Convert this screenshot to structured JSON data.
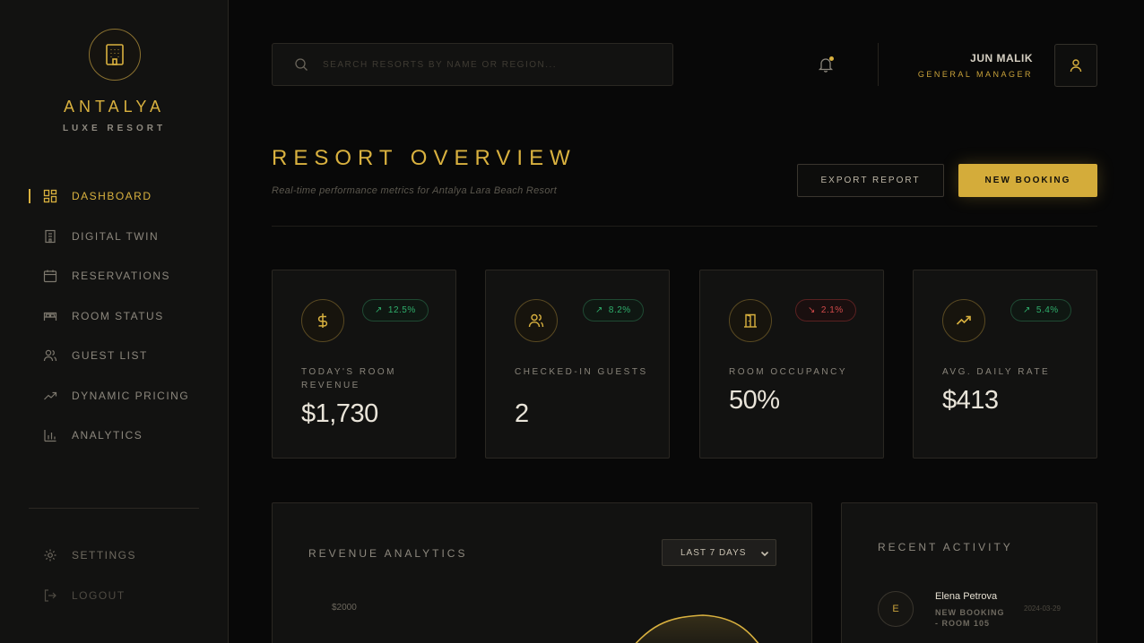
{
  "brand": {
    "name": "ANTALYA",
    "subtitle": "LUXE RESORT"
  },
  "sidebar": {
    "items": [
      {
        "label": "DASHBOARD",
        "icon": "dashboard-grid-icon",
        "active": true
      },
      {
        "label": "DIGITAL TWIN",
        "icon": "building-icon"
      },
      {
        "label": "RESERVATIONS",
        "icon": "calendar-icon"
      },
      {
        "label": "ROOM STATUS",
        "icon": "bed-icon"
      },
      {
        "label": "GUEST LIST",
        "icon": "users-icon"
      },
      {
        "label": "DYNAMIC PRICING",
        "icon": "trend-up-icon"
      },
      {
        "label": "ANALYTICS",
        "icon": "bar-chart-icon"
      }
    ],
    "footer": [
      {
        "label": "SETTINGS",
        "icon": "gear-icon"
      },
      {
        "label": "LOGOUT",
        "icon": "logout-icon"
      }
    ]
  },
  "header": {
    "search_placeholder": "SEARCH RESORTS BY NAME OR REGION...",
    "user_name": "JUN MALIK",
    "user_role": "GENERAL MANAGER"
  },
  "page": {
    "title": "RESORT OVERVIEW",
    "subtitle": "Real-time performance metrics for Antalya Lara Beach Resort",
    "export_label": "EXPORT REPORT",
    "new_booking_label": "NEW BOOKING"
  },
  "stats": [
    {
      "label": "TODAY'S ROOM REVENUE",
      "value": "$1,730",
      "change": "12.5%",
      "trend": "up",
      "icon": "dollar-icon"
    },
    {
      "label": "CHECKED-IN GUESTS",
      "value": "2",
      "change": "8.2%",
      "trend": "up",
      "icon": "users-icon"
    },
    {
      "label": "ROOM OCCUPANCY",
      "value": "50%",
      "change": "2.1%",
      "trend": "down",
      "icon": "door-icon"
    },
    {
      "label": "AVG. DAILY RATE",
      "value": "$413",
      "change": "5.4%",
      "trend": "up",
      "icon": "trend-up-icon"
    }
  ],
  "revenue": {
    "title": "REVENUE ANALYTICS",
    "range": "LAST 7 DAYS",
    "y_tick": "$2000"
  },
  "activity": {
    "title": "RECENT ACTIVITY",
    "items": [
      {
        "initial": "E",
        "name": "Elena Petrova",
        "desc": "NEW BOOKING - ROOM 105",
        "date": "2024-03-29"
      }
    ]
  },
  "colors": {
    "accent": "#d9b13f",
    "background": "#080808",
    "panel": "#121211",
    "up": "#2fae6b",
    "down": "#d24a4a"
  }
}
